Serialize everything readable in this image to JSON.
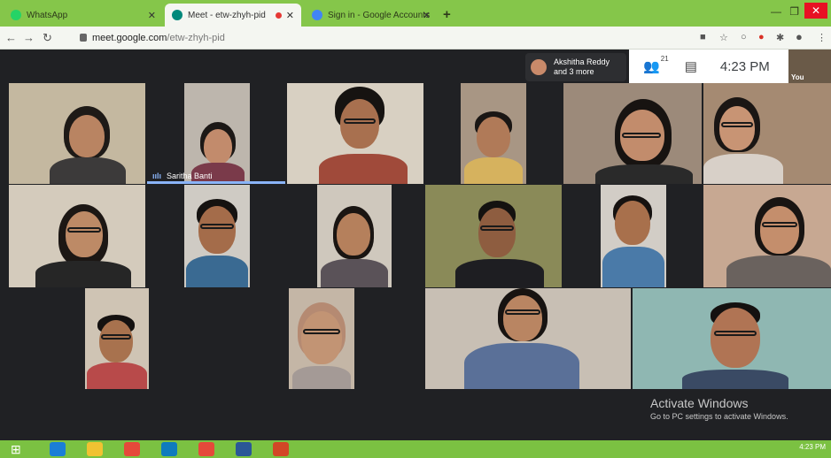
{
  "browser": {
    "tabs": [
      {
        "title": "WhatsApp",
        "color": "#25d366"
      },
      {
        "title": "Meet - etw-zhyh-pid",
        "color": "#00897b"
      },
      {
        "title": "Sign in - Google Accounts",
        "color": "#4285f4"
      }
    ],
    "new_tab": "+",
    "address": {
      "domain": "meet.google.com",
      "path": "/etw-zhyh-pid"
    }
  },
  "meet": {
    "presenter": {
      "line1": "Akshitha Reddy",
      "line2": "and 3 more"
    },
    "participants_count": "21",
    "time": "4:23 PM",
    "self_label": "You",
    "speaker_name": "Saritha Banti"
  },
  "watermark": {
    "title": "Activate Windows",
    "subtitle": "Go to PC settings to activate Windows."
  },
  "taskbar": {
    "clock": "4:23 PM"
  }
}
